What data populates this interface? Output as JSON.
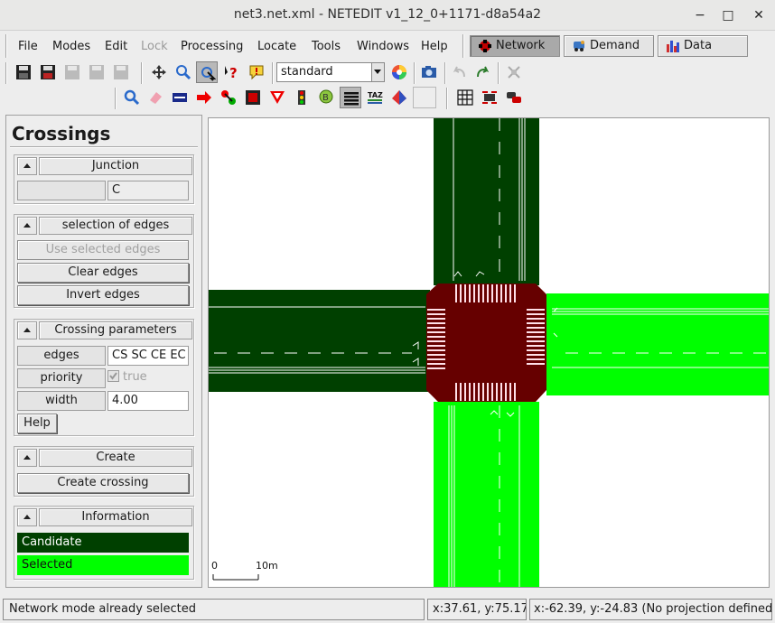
{
  "window": {
    "title": "net3.net.xml - NETEDIT v1_12_0+1171-d8a54a2",
    "minimize_glyph": "−",
    "maximize_glyph": "□",
    "close_glyph": "✕"
  },
  "menu": {
    "items": [
      "File",
      "Modes",
      "Edit",
      "Lock",
      "Processing",
      "Locate",
      "Tools",
      "Windows",
      "Help"
    ],
    "disabled": [
      "Lock"
    ]
  },
  "supermodes": [
    {
      "label": "Network",
      "active": true,
      "icon": "network-icon"
    },
    {
      "label": "Demand",
      "active": false,
      "icon": "demand-icon"
    },
    {
      "label": "Data",
      "active": false,
      "icon": "data-icon"
    }
  ],
  "toolbar": {
    "scheme_value": "standard"
  },
  "frame": {
    "title": "Crossings",
    "junction": {
      "title": "Junction",
      "value": "C"
    },
    "edges_selection": {
      "title": "selection of edges",
      "use_selected": "Use selected edges",
      "clear": "Clear edges",
      "invert": "Invert edges"
    },
    "parameters": {
      "title": "Crossing parameters",
      "edges_label": "edges",
      "edges_value": "CS SC CE EC",
      "priority_label": "priority",
      "priority_value": "true",
      "priority_checked": true,
      "width_label": "width",
      "width_value": "4.00",
      "help": "Help"
    },
    "create": {
      "title": "Create",
      "button": "Create crossing"
    },
    "information": {
      "title": "Information",
      "candidate": "Candidate",
      "candidate_color": "#004000",
      "selected": "Selected",
      "selected_color": "#00ff00"
    }
  },
  "canvas": {
    "scale_start": "0",
    "scale_end": "10m",
    "junction_color": "#660000",
    "candidate_color": "#004000",
    "selected_color": "#00ff00"
  },
  "status": {
    "message": "Network mode already selected",
    "cursor": "x:37.61, y:75.17",
    "geo": "x:-62.39, y:-24.83 (No projection defined)"
  }
}
